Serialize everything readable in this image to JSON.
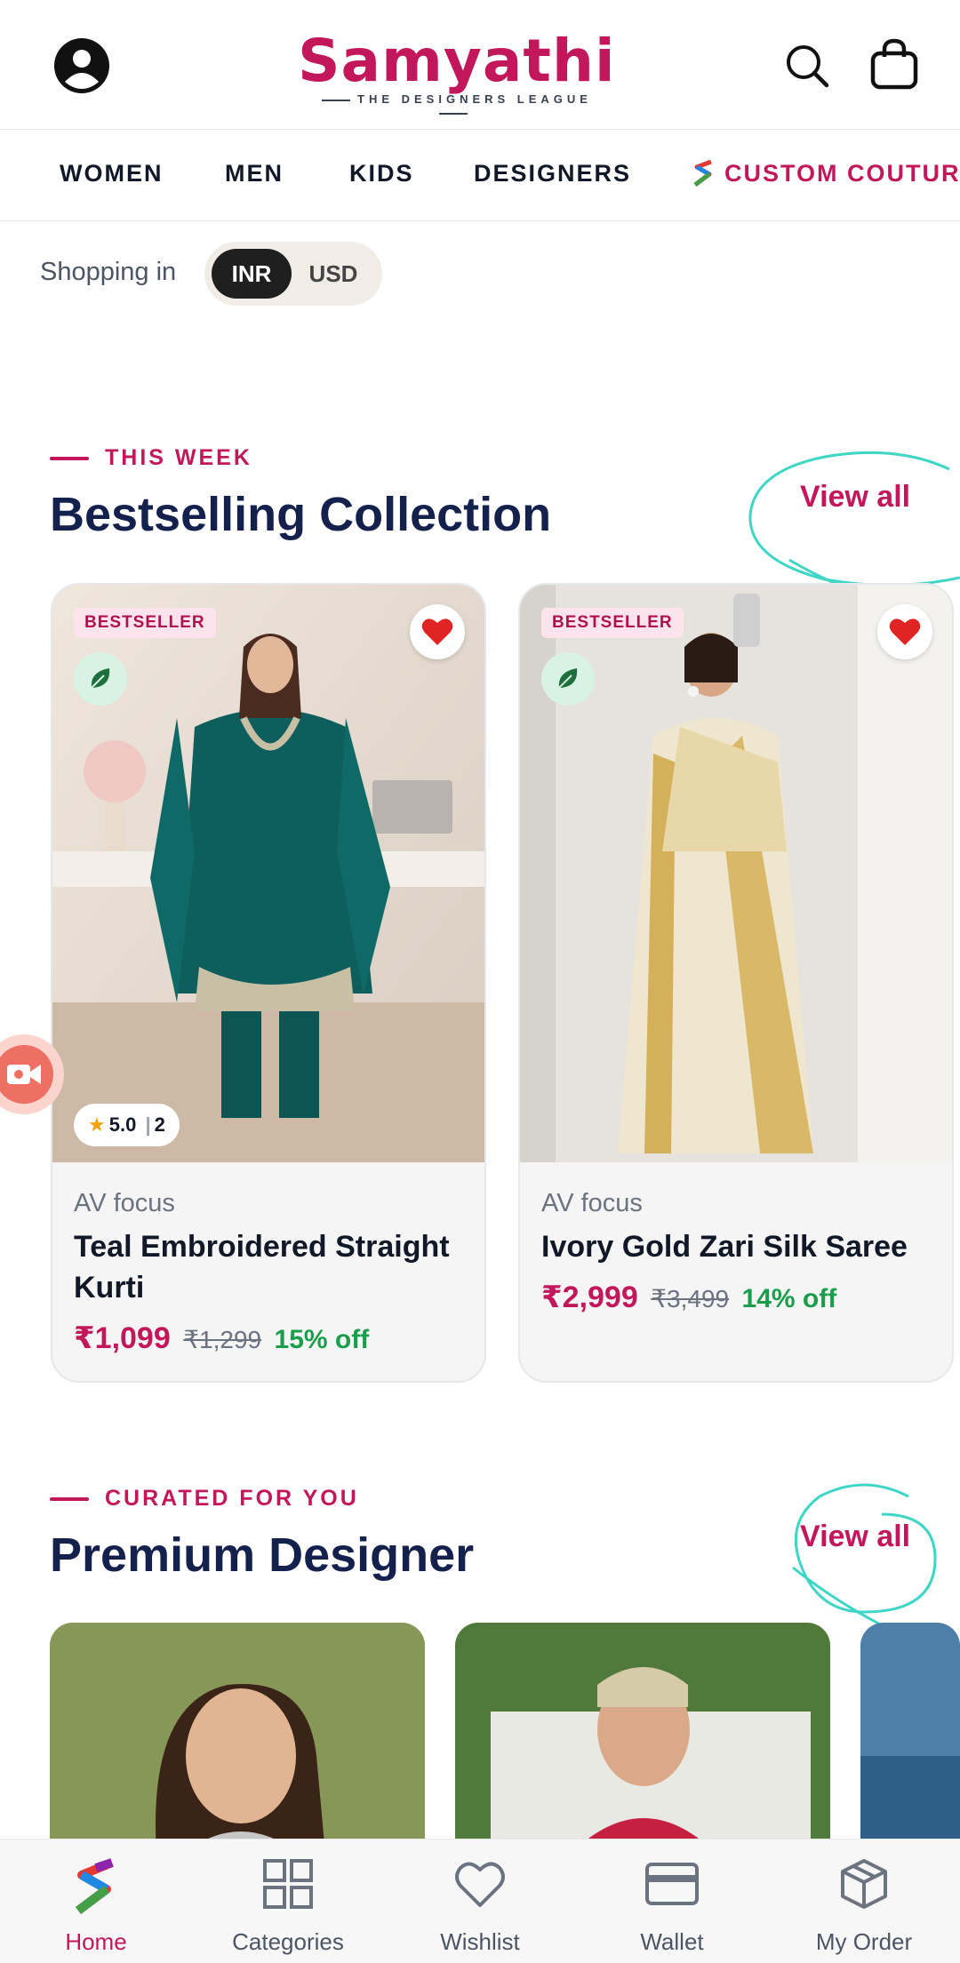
{
  "header": {
    "logo_text": "Samyathi",
    "tagline": "THE DESIGNERS LEAGUE",
    "icons": [
      "account-icon",
      "search-icon",
      "bag-icon"
    ]
  },
  "nav": {
    "items": [
      "WOMEN",
      "MEN",
      "KIDS",
      "DESIGNERS",
      "CUSTOM COUTURE"
    ]
  },
  "currency": {
    "label": "Shopping in",
    "options": [
      "INR",
      "USD"
    ],
    "selected": "INR"
  },
  "bestselling": {
    "eyebrow": "THIS WEEK",
    "title": "Bestselling Collection",
    "view_all": "View all",
    "products": [
      {
        "badge": "BESTSELLER",
        "brand": "AV focus",
        "name": "Teal Embroidered Straight Kurti",
        "price": "₹1,099",
        "mrp": "₹1,299",
        "discount": "15% off",
        "rating": "5.0",
        "reviews": "2",
        "wishlisted": true
      },
      {
        "badge": "BESTSELLER",
        "brand": "AV focus",
        "name": "Ivory Gold Zari Silk Saree",
        "price": "₹2,999",
        "mrp": "₹3,499",
        "discount": "14% off",
        "wishlisted": true
      }
    ]
  },
  "designers": {
    "eyebrow": "CURATED FOR YOU",
    "title": "Premium Designer",
    "view_all": "View all"
  },
  "bottom_nav": {
    "items": [
      "Home",
      "Categories",
      "Wishlist",
      "Wallet",
      "My Order"
    ],
    "active": "Home"
  },
  "colors": {
    "accent": "#c2185b",
    "title": "#15214d",
    "discount": "#1a9e4b",
    "scribble": "#3fd6c6"
  }
}
